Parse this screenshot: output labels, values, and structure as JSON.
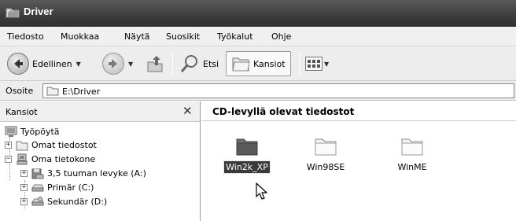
{
  "window": {
    "title": "Driver"
  },
  "menu": [
    "Tiedosto",
    "Muokkaa",
    "Näytä",
    "Suosikit",
    "Työkalut",
    "Ohje"
  ],
  "toolbar": {
    "back_label": "Edellinen",
    "search_label": "Etsi",
    "folders_label": "Kansiot"
  },
  "address": {
    "label": "Osoite",
    "value": "E:\\Driver"
  },
  "folder_pane": {
    "title": "Kansiot",
    "close_glyph": "✕",
    "items": [
      {
        "label": "Työpöytä",
        "icon": "desktop-icon",
        "expander": ""
      },
      {
        "label": "Omat tiedostot",
        "icon": "folder-icon",
        "expander": "+"
      },
      {
        "label": "Oma tietokone",
        "icon": "computer-icon",
        "expander": "−"
      },
      {
        "label": "3,5 tuuman levyke (A:)",
        "icon": "floppy-icon",
        "expander": "+"
      },
      {
        "label": "Primär (C:)",
        "icon": "drive-icon",
        "expander": "+"
      },
      {
        "label": "Sekundär (D:)",
        "icon": "drive-icon",
        "expander": "+"
      }
    ]
  },
  "content": {
    "header": "CD-levyllä olevat tiedostot",
    "files": [
      {
        "name": "Win2k_XP",
        "selected": true
      },
      {
        "name": "Win98SE",
        "selected": false
      },
      {
        "name": "WinME",
        "selected": false
      }
    ]
  }
}
